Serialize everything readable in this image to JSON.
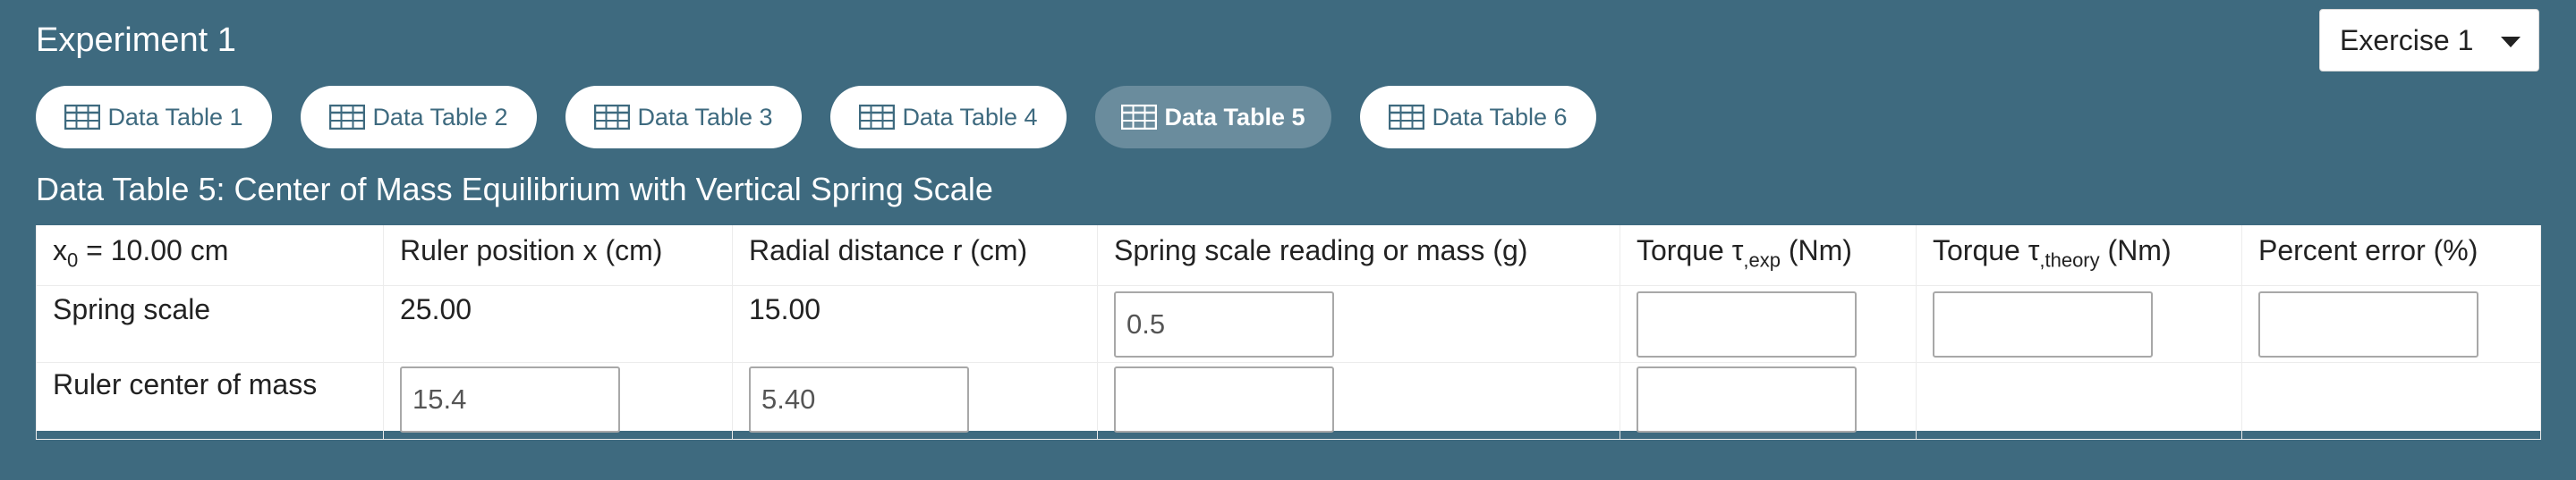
{
  "experiment": {
    "title": "Experiment 1"
  },
  "exercise_select": {
    "selected": "Exercise 1"
  },
  "tabs": [
    {
      "label": "Data Table 1",
      "active": false
    },
    {
      "label": "Data Table 2",
      "active": false
    },
    {
      "label": "Data Table 3",
      "active": false
    },
    {
      "label": "Data Table 4",
      "active": false
    },
    {
      "label": "Data Table 5",
      "active": true
    },
    {
      "label": "Data Table 6",
      "active": false
    }
  ],
  "table": {
    "title": "Data Table 5: Center of Mass Equilibrium with Vertical Spring Scale",
    "headers": {
      "x0_prefix": "x",
      "x0_sub": "0",
      "x0_suffix": " = 10.00 cm",
      "ruler_position": "Ruler position x (cm)",
      "radial_distance": "Radial distance r (cm)",
      "spring_reading": "Spring scale reading or mass (g)",
      "torque_exp_prefix": "Torque τ",
      "torque_exp_sub": ",exp",
      "torque_exp_suffix": " (Nm)",
      "torque_theory_prefix": "Torque τ",
      "torque_theory_sub": ",theory",
      "torque_theory_suffix": " (Nm)",
      "percent_error": "Percent error (%)"
    },
    "rows": [
      {
        "label": "Spring scale",
        "ruler_position": "25.00",
        "radial_distance": "15.00",
        "spring_reading": "0.5",
        "torque_exp": "",
        "torque_theory": "",
        "percent_error": ""
      },
      {
        "label": "Ruler center of mass",
        "ruler_position": "15.4",
        "radial_distance": "5.40",
        "spring_reading": "",
        "torque_exp": ""
      }
    ]
  },
  "icons": {
    "tab_icon": "table-icon",
    "dropdown_icon": "caret-down-icon"
  },
  "colors": {
    "background": "#3e6a7f",
    "tab_active": "#6a8c9d",
    "tab_text": "#3e6a7f"
  }
}
